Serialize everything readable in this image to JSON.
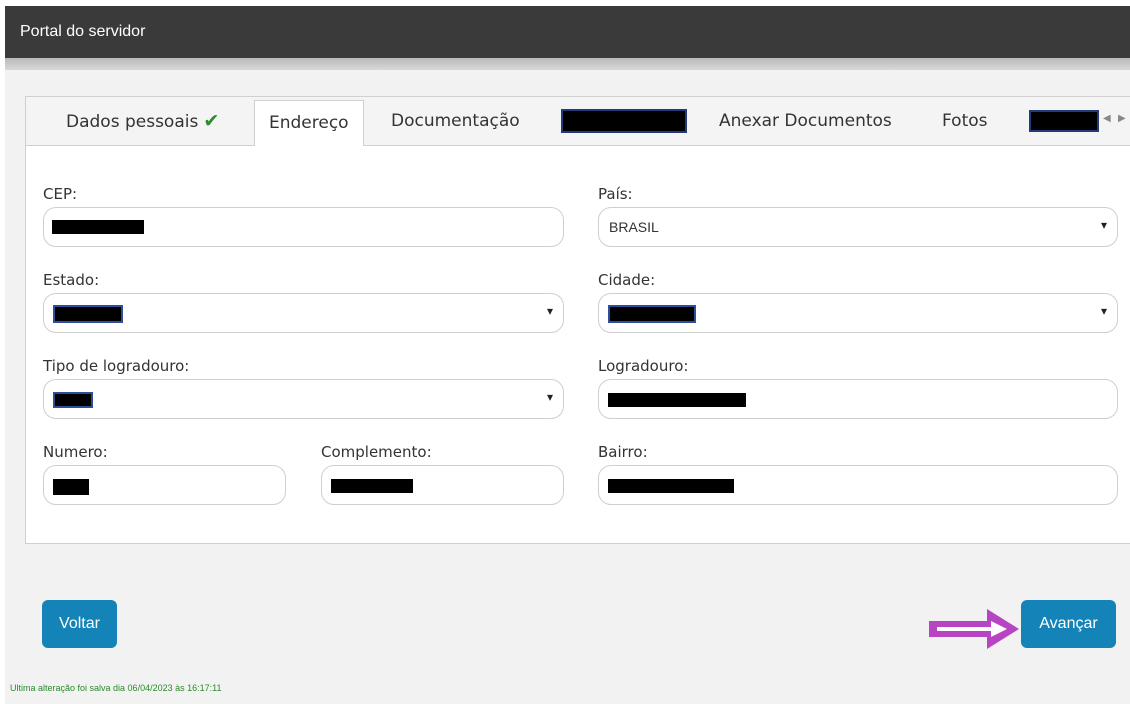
{
  "header": {
    "title": "Portal do servidor"
  },
  "tabs": [
    {
      "label": "Dados pessoais"
    },
    {
      "label": "Endereço"
    },
    {
      "label": "Documentação"
    },
    {
      "label": "Anexar Documentos"
    },
    {
      "label": "Fotos"
    }
  ],
  "form": {
    "cep": {
      "label": "CEP:"
    },
    "pais": {
      "label": "País:",
      "value": "BRASIL"
    },
    "estado": {
      "label": "Estado:"
    },
    "cidade": {
      "label": "Cidade:"
    },
    "tipo_logradouro": {
      "label": "Tipo de logradouro:"
    },
    "logradouro": {
      "label": "Logradouro:"
    },
    "numero": {
      "label": "Numero:"
    },
    "complemento": {
      "label": "Complemento:"
    },
    "bairro": {
      "label": "Bairro:"
    }
  },
  "buttons": {
    "back": "Voltar",
    "next": "Avançar"
  },
  "footer": {
    "status": "Ultima alteração foi salva dia 06/04/2023 às 16:17:11"
  },
  "colors": {
    "primary_button": "#1483b8",
    "check": "#2e8b2e",
    "annotation_arrow": "#b744c2"
  }
}
